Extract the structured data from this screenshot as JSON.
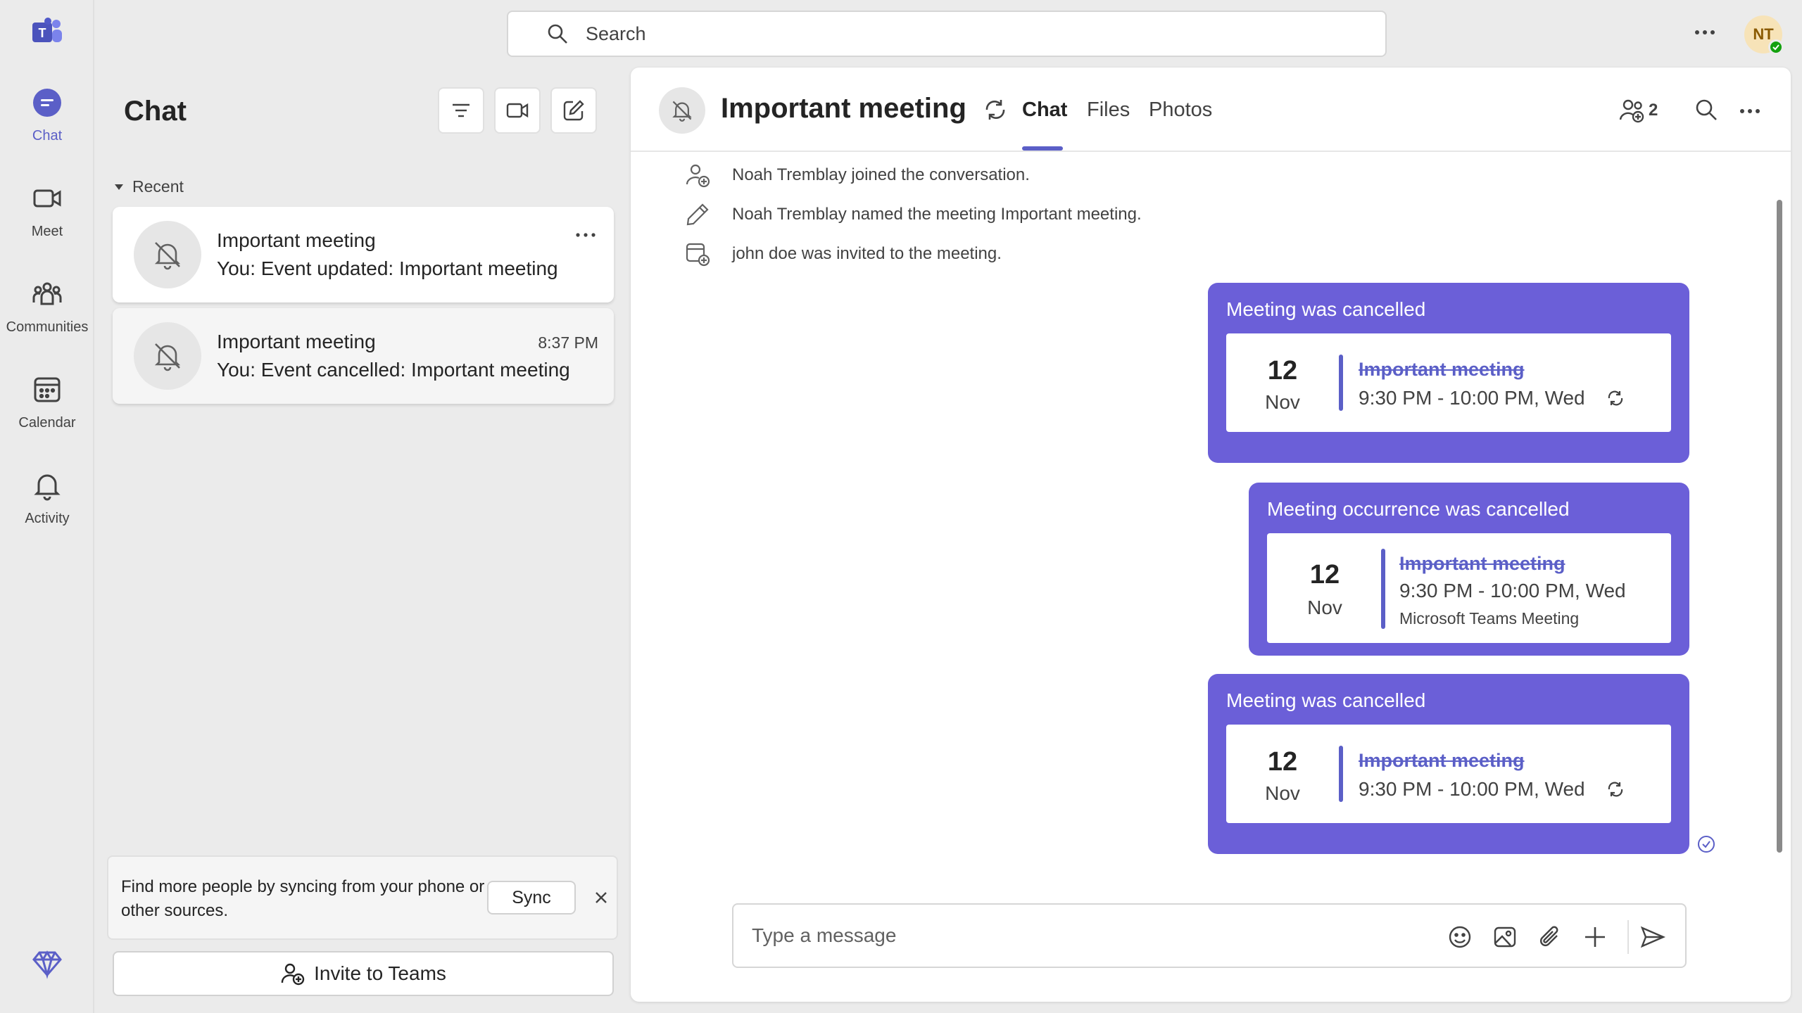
{
  "rail": {
    "items": [
      {
        "label": "Chat"
      },
      {
        "label": "Meet"
      },
      {
        "label": "Communities"
      },
      {
        "label": "Calendar"
      },
      {
        "label": "Activity"
      }
    ]
  },
  "topbar": {
    "search_placeholder": "Search",
    "user_initials": "NT"
  },
  "chat_list": {
    "title": "Chat",
    "section": "Recent",
    "items": [
      {
        "name": "Important meeting",
        "preview": "You: Event updated: Important meeting",
        "time": ""
      },
      {
        "name": "Important meeting",
        "preview": "You: Event cancelled: Important meeting",
        "time": "8:37 PM"
      }
    ],
    "sync_text": "Find more people by syncing from your phone or other sources.",
    "sync_label": "Sync",
    "invite_label": "Invite to Teams"
  },
  "conversation": {
    "title": "Important meeting",
    "tabs": [
      {
        "label": "Chat"
      },
      {
        "label": "Files"
      },
      {
        "label": "Photos"
      }
    ],
    "participant_count": "2",
    "system_messages": [
      "Noah Tremblay joined the conversation.",
      "Noah Tremblay named the meeting Important meeting.",
      "john doe was invited to the meeting."
    ],
    "cards": [
      {
        "header": "Meeting was cancelled",
        "day": "12",
        "month": "Nov",
        "title": "Important meeting",
        "time": "9:30 PM - 10:00 PM, Wed",
        "subtitle": ""
      },
      {
        "header": "Meeting occurrence was cancelled",
        "day": "12",
        "month": "Nov",
        "title": "Important meeting",
        "time": "9:30 PM - 10:00 PM, Wed",
        "subtitle": "Microsoft Teams Meeting"
      },
      {
        "header": "Meeting was cancelled",
        "day": "12",
        "month": "Nov",
        "title": "Important meeting",
        "time": "9:30 PM - 10:00 PM, Wed",
        "subtitle": ""
      }
    ],
    "composer_placeholder": "Type a message"
  },
  "colors": {
    "accent": "#5b5fc7",
    "card_bg": "#6b5fd8",
    "presence": "#13a10e"
  }
}
